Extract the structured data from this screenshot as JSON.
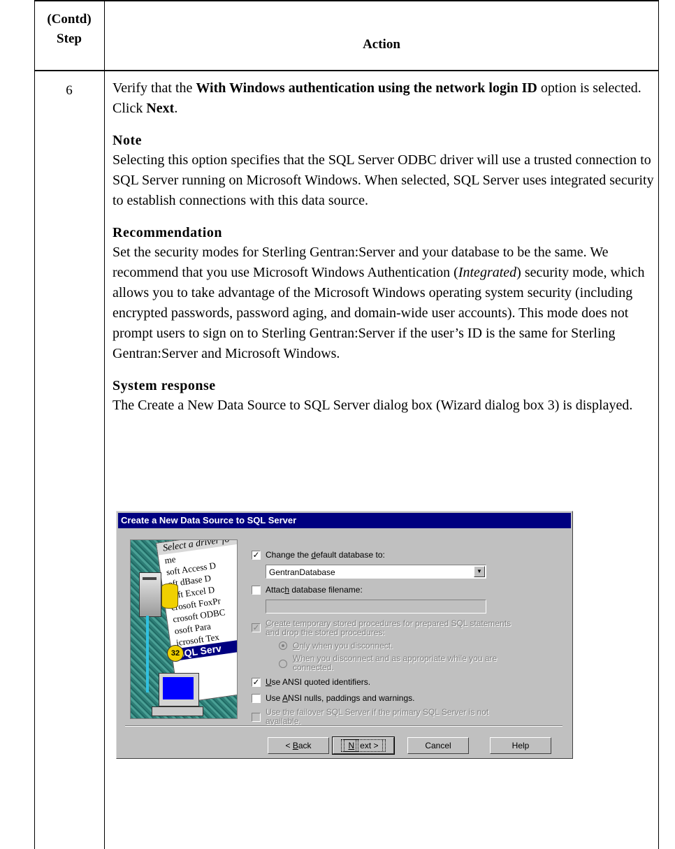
{
  "table": {
    "header": {
      "step_line1": "(Contd)",
      "step_line2": "Step",
      "action": "Action"
    },
    "step_number": "6"
  },
  "action": {
    "para1": {
      "pre": "Verify that the ",
      "bold": "With Windows authentication using the network login ID",
      "mid": " option is selected. Click ",
      "bold2": "Next",
      "end": "."
    },
    "note": {
      "heading": "Note",
      "text": "Selecting this option specifies that the SQL Server ODBC driver will use a trusted connection to SQL Server running on Microsoft Windows. When selected, SQL Server uses integrated security to establish connections with this data source."
    },
    "recommendation": {
      "heading": "Recommendation",
      "text_pre": "Set the security modes for Sterling Gentran:Server and your database to be the same. We recommend that you use Microsoft Windows Authentication (",
      "text_italic": "Integrated",
      "text_post": ") security mode, which allows you to take advantage of the Microsoft Windows operating system security (including encrypted passwords, password aging, and domain-wide user accounts). This mode does not prompt users to sign on to Sterling Gentran:Server if the user’s ID is the same for Sterling Gentran:Server and Microsoft Windows."
    },
    "system_response": {
      "heading": "System response",
      "text": "The Create a New Data Source to SQL Server dialog box (Wizard dialog box 3) is displayed."
    }
  },
  "dialog": {
    "title": "Create a New Data Source to SQL Server",
    "art": {
      "header_text": "Select a driver fo",
      "col_text": "me",
      "list": [
        "soft Access D",
        "oft dBase D",
        "soft Excel D",
        "crosoft FoxPr",
        "crosoft ODBC",
        "osoft Para",
        "icrosoft Tex"
      ],
      "selected": "SQL Serv",
      "badge": "32"
    },
    "options": {
      "change_default_db": {
        "pre": "Change the ",
        "u": "d",
        "post": "efault database to:",
        "checked": true
      },
      "database_value": "GentranDatabase",
      "attach_filename": {
        "pre": "Attac",
        "u": "h",
        "post": " database filename:",
        "checked": false
      },
      "create_temp_line1": {
        "u": "C",
        "post": "reate temporary stored procedures for prepared SQL statements"
      },
      "create_temp_line2": "and drop the stored procedures:",
      "only_disconnect": {
        "u": "O",
        "post": "nly when you disconnect."
      },
      "when_disconnect_line1": {
        "u": "W",
        "post": "hen you disconnect and as appropriate while you are"
      },
      "when_disconnect_line2": "connected.",
      "ansi_quoted": {
        "u": "U",
        "post": "se ANSI quoted identifiers.",
        "checked": true
      },
      "ansi_nulls": {
        "pre": "Use ",
        "u": "A",
        "post": "NSI nulls, paddings and warnings.",
        "checked": false
      },
      "failover_line1": "Use the failover SQL Server if the primary SQL Server is not",
      "failover_line2": "available."
    },
    "buttons": {
      "back": {
        "pre": "< ",
        "u": "B",
        "post": "ack"
      },
      "next": {
        "u": "N",
        "post": "ext >"
      },
      "cancel": "Cancel",
      "help": "Help"
    }
  }
}
